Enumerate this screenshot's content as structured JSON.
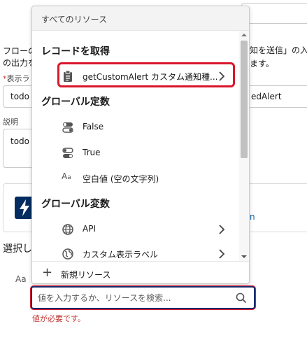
{
  "background": {
    "flow_text_left": "フローの",
    "flow_text_left2": "の出力を",
    "flow_text_right": "知を送信」の入",
    "flow_text_right2": "ます。",
    "display_label_star": "*",
    "display_label": "表示ラ",
    "display_value_left": "todo",
    "display_value_right": "edAlert",
    "description_label": "説明",
    "description_value": "todo",
    "card_right_text": "n",
    "selection_label": "選択し",
    "text_icon": "Aa"
  },
  "dropdown": {
    "header": "すべてのリソース",
    "sections": [
      {
        "title": "レコードを取得"
      },
      {
        "title": "グローバル定数"
      },
      {
        "title": "グローバル変数"
      }
    ],
    "items": [
      {
        "label": "getCustomAlert カスタム通知種...",
        "icon": "clipboard-icon",
        "has_chevron": true
      },
      {
        "label": "False",
        "icon": "toggle-off-icon",
        "has_chevron": false
      },
      {
        "label": "True",
        "icon": "toggle-on-icon",
        "has_chevron": false
      },
      {
        "label": "空白値 (空の文字列)",
        "icon": "text-icon",
        "has_chevron": false
      },
      {
        "label": "API",
        "icon": "globe-icon",
        "has_chevron": true
      },
      {
        "label": "カスタム表示ラベル",
        "icon": "globe-icon",
        "has_chevron": true
      }
    ],
    "footer": {
      "label": "新規リソース",
      "icon": "plus-icon"
    }
  },
  "search": {
    "placeholder": "値を入力するか、リソースを検索...",
    "value": "",
    "error": "値が必要です。"
  },
  "colors": {
    "highlight": "#d9162b",
    "focus_border": "#1b2a6b",
    "error_text": "#c23934",
    "card_icon_bg": "#032d60"
  }
}
